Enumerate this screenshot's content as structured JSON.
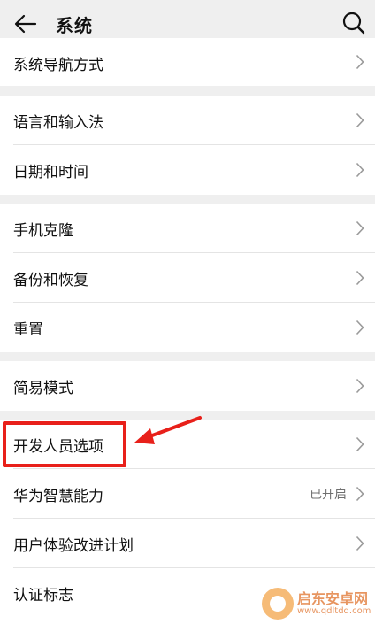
{
  "header": {
    "title": "系统",
    "back_icon": "back-arrow-icon",
    "search_icon": "search-icon"
  },
  "groups": [
    {
      "items": [
        {
          "label": "系统导航方式",
          "value": ""
        }
      ]
    },
    {
      "items": [
        {
          "label": "语言和输入法",
          "value": ""
        },
        {
          "label": "日期和时间",
          "value": ""
        }
      ]
    },
    {
      "items": [
        {
          "label": "手机克隆",
          "value": ""
        },
        {
          "label": "备份和恢复",
          "value": ""
        },
        {
          "label": "重置",
          "value": ""
        }
      ]
    },
    {
      "items": [
        {
          "label": "简易模式",
          "value": ""
        }
      ]
    },
    {
      "items": [
        {
          "label": "开发人员选项",
          "value": ""
        },
        {
          "label": "华为智慧能力",
          "value": "已开启"
        },
        {
          "label": "用户体验改进计划",
          "value": ""
        },
        {
          "label": "认证标志",
          "value": ""
        }
      ]
    }
  ],
  "annotation": {
    "highlight_color": "#e8201a"
  },
  "watermark": {
    "name": "启东安卓网",
    "url": "www.qdltdq.com"
  }
}
